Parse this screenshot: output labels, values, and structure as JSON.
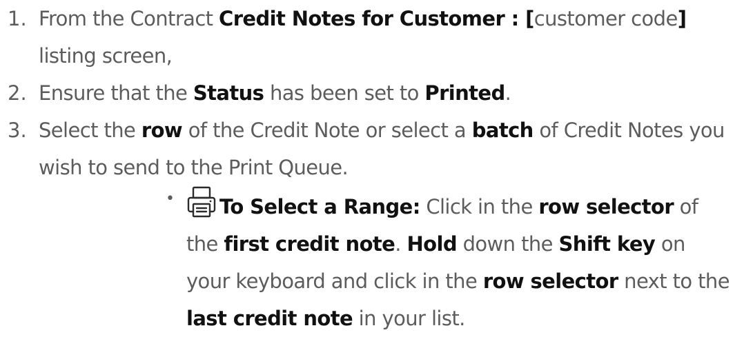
{
  "steps": [
    {
      "num": "1.",
      "parts": {
        "t1": "From the Contract ",
        "b1": "Credit Notes for Customer : [",
        "t2": "customer code",
        "b2": "]",
        "t3": " listing screen,"
      }
    },
    {
      "num": "2.",
      "parts": {
        "t1": "Ensure that the ",
        "b1": "Status",
        "t2": " has been set to ",
        "b2": "Printed",
        "t3": "."
      }
    },
    {
      "num": "3.",
      "parts": {
        "t1": "Select the ",
        "b1": "row",
        "t2": " of the Credit Note or select a ",
        "b2": "batch",
        "t3": " of Credit Notes you wish to send to the Print Queue."
      }
    }
  ],
  "tip": {
    "bullet": "•",
    "icon": "printer-icon",
    "title": "To Select a Range:",
    "t1": " Click in the ",
    "b1": "row selector",
    "t2": " of the ",
    "b2": "first credit note",
    "t3": ". ",
    "b3": "Hold",
    "t4": " down the ",
    "b4": "Shift key",
    "t5": " on your keyboard and click in the ",
    "b5": "row selector",
    "t6": " next to the ",
    "b6": "last credit note",
    "t7": " in your list."
  },
  "colors": {
    "body_text": "#5c5c5c",
    "emphasis_text": "#111111",
    "background": "#ffffff"
  }
}
